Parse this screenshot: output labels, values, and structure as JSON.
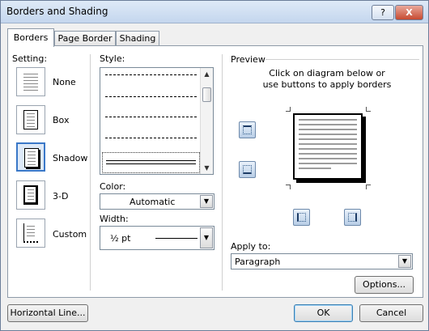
{
  "window": {
    "title": "Borders and Shading",
    "help_label": "?",
    "close_label": "X"
  },
  "tabs": [
    {
      "label": "Borders",
      "active": true
    },
    {
      "label": "Page Border",
      "active": false
    },
    {
      "label": "Shading",
      "active": false
    }
  ],
  "setting": {
    "label": "Setting:",
    "items": [
      {
        "label": "None",
        "selected": false
      },
      {
        "label": "Box",
        "selected": false
      },
      {
        "label": "Shadow",
        "selected": true
      },
      {
        "label": "3-D",
        "selected": false
      },
      {
        "label": "Custom",
        "selected": false
      }
    ]
  },
  "style": {
    "label": "Style:"
  },
  "color": {
    "label": "Color:",
    "value": "Automatic"
  },
  "width": {
    "label": "Width:",
    "value": "½ pt"
  },
  "preview": {
    "label": "Preview",
    "instructions": "Click on diagram below or use buttons to apply borders"
  },
  "apply_to": {
    "label": "Apply to:",
    "value": "Paragraph"
  },
  "buttons": {
    "options": "Options...",
    "horizontal_line": "Horizontal Line...",
    "ok": "OK",
    "cancel": "Cancel"
  }
}
